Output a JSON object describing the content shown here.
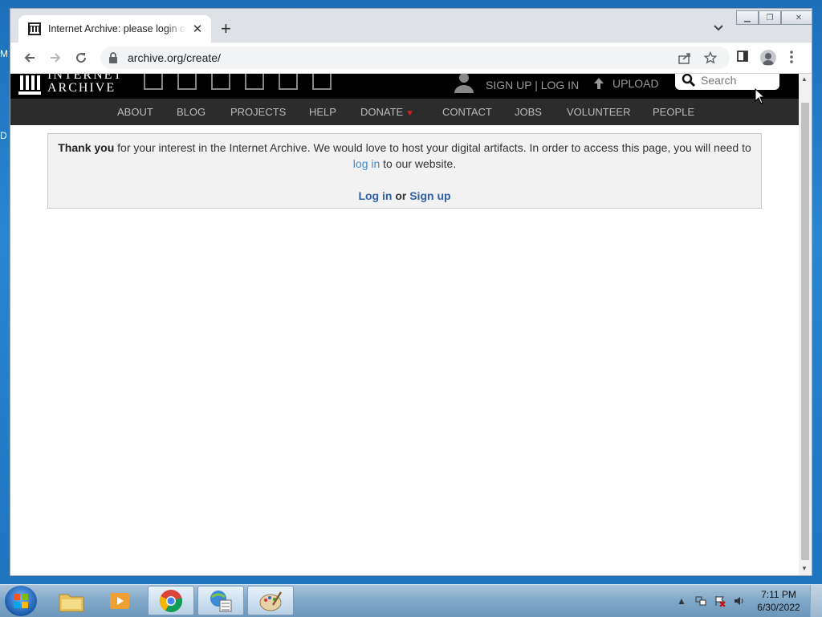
{
  "browser": {
    "tab_title": "Internet Archive: please login or join",
    "tab_close": "✕",
    "new_tab": "+",
    "url": "archive.org/create/"
  },
  "ia": {
    "logo_line1": "INTERNET",
    "logo_line2": "ARCHIVE",
    "signup_login": "SIGN UP | LOG IN",
    "upload": "UPLOAD",
    "search_placeholder": "Search",
    "nav": [
      "ABOUT",
      "BLOG",
      "PROJECTS",
      "HELP",
      "DONATE",
      "CONTACT",
      "JOBS",
      "VOLUNTEER",
      "PEOPLE"
    ]
  },
  "notice": {
    "thank_you": "Thank you",
    "text1": " for your interest in the Internet Archive. We would love to host your digital artifacts. In order to access this page, you will need to ",
    "login_link": "log in",
    "text2": " to our website.",
    "login_button": "Log in",
    "or": "or",
    "signup_button": "Sign up"
  },
  "taskbar": {
    "time": "7:11 PM",
    "date": "6/30/2022"
  },
  "desktop_edge": [
    "M",
    "D"
  ],
  "colors": {
    "link": "#428bca",
    "heart": "#d42020",
    "ia_bar": "#000000",
    "ia_nav": "#2c2c2c"
  }
}
